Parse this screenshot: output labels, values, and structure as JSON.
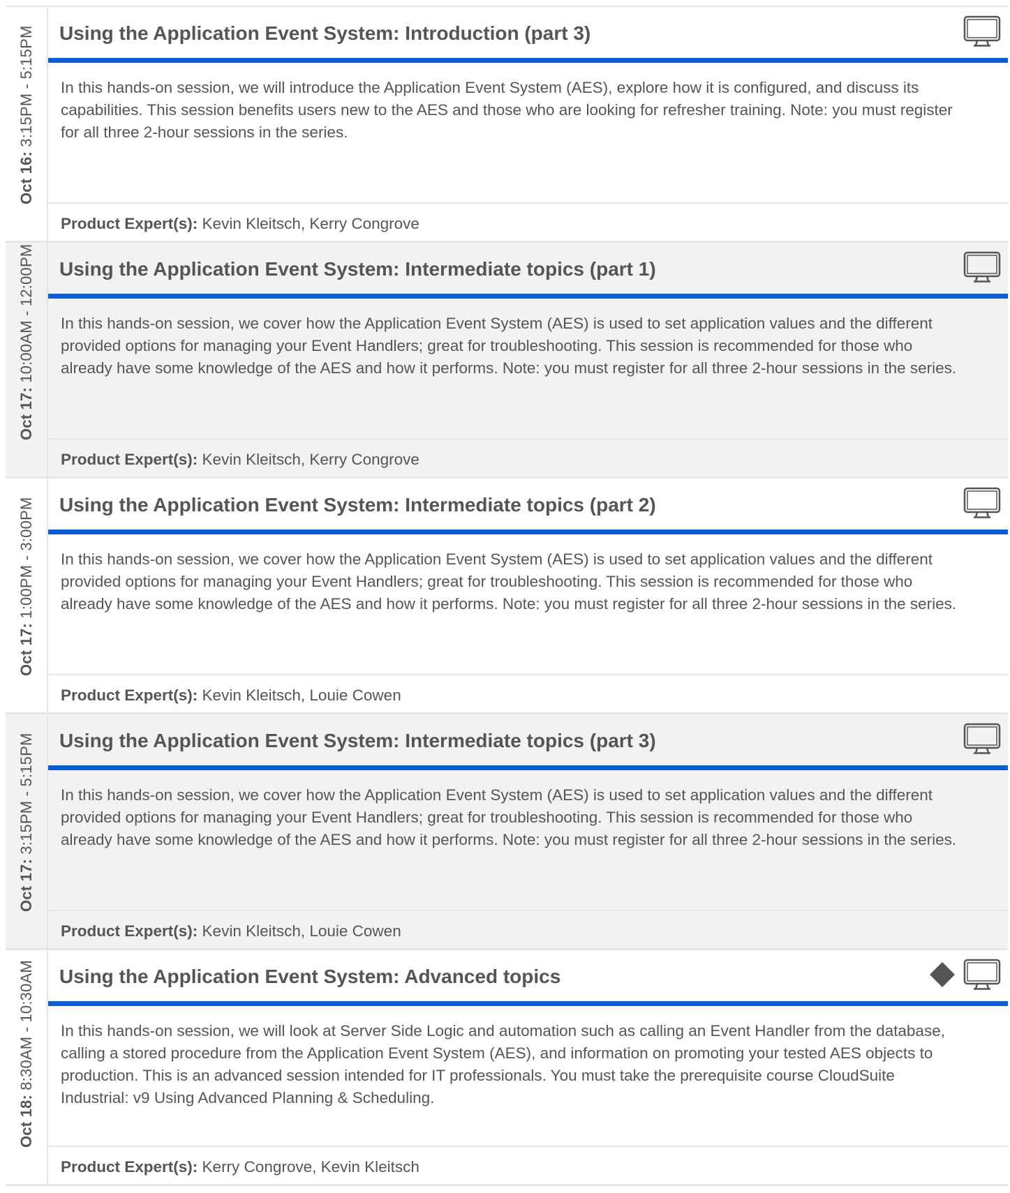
{
  "expert_label": "Product Expert(s):",
  "sessions": [
    {
      "date": "Oct 16:",
      "time": "3:15PM - 5:15PM",
      "title": "Using the Application Event System: Introduction (part 3)",
      "description": "In this hands-on session, we will introduce the Application Event System (AES), explore how it is configured, and discuss its capabilities. This session benefits users new to the AES and those who are looking for refresher training. Note: you must register for all three 2-hour sessions in the series.",
      "experts": "Kevin Kleitsch, Kerry Congrove",
      "icons": [
        "monitor-icon"
      ]
    },
    {
      "date": "Oct 17:",
      "time": "10:00AM - 12:00PM",
      "title": "Using the Application Event System: Intermediate topics (part 1)",
      "description": "In this hands-on session, we cover how the Application Event System (AES) is used to set application values and the different provided options for managing your Event Handlers; great for troubleshooting. This session is recommended for those who already have some knowledge of the AES and how it performs. Note: you must register for all three 2-hour sessions in the series.",
      "experts": "Kevin Kleitsch, Kerry Congrove",
      "icons": [
        "monitor-icon"
      ]
    },
    {
      "date": "Oct 17:",
      "time": "1:00PM - 3:00PM",
      "title": "Using the Application Event System: Intermediate topics (part 2)",
      "description": "In this hands-on session, we cover how the Application Event System (AES) is used to set application values and the different provided options for managing your Event Handlers; great for troubleshooting. This session is recommended for those who already have some knowledge of the AES and how it performs. Note: you must register for all three 2-hour sessions in the series.",
      "experts": "Kevin Kleitsch, Louie Cowen",
      "icons": [
        "monitor-icon"
      ]
    },
    {
      "date": "Oct 17:",
      "time": "3:15PM - 5:15PM",
      "title": "Using the Application Event System: Intermediate topics (part 3)",
      "description": "In this hands-on session, we cover how the Application Event System (AES) is used to set application values and the different provided options for managing your Event Handlers; great for troubleshooting. This session is recommended for those who already have some knowledge of the AES and how it performs. Note: you must register for all three 2-hour sessions in the series.",
      "experts": "Kevin Kleitsch, Louie Cowen",
      "icons": [
        "monitor-icon"
      ]
    },
    {
      "date": "Oct 18:",
      "time": "8:30AM - 10:30AM",
      "title": "Using the Application Event System: Advanced topics",
      "description": "In this hands-on session, we will look at Server Side Logic and automation such as calling an Event Handler from the database, calling a stored procedure from the Application Event System (AES), and information on promoting your tested AES objects to production. This is an advanced session intended for IT professionals. You must take the prerequisite course CloudSuite Industrial: v9 Using Advanced Planning & Scheduling.",
      "experts": "Kerry Congrove, Kevin Kleitsch",
      "icons": [
        "diamond-icon",
        "monitor-icon"
      ]
    }
  ],
  "colors": {
    "accent": "#0a5fd8",
    "text": "#555555",
    "border": "#e6e6e6",
    "alt_row": "#f2f2f2",
    "icon": "#555555"
  }
}
